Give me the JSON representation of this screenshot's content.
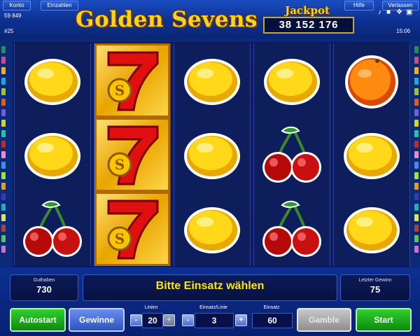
{
  "header": {
    "menu": [
      "Konto",
      "Einzahlen",
      "Hilfe",
      "Verlassen"
    ],
    "account_value": "59 849",
    "ticket": "#25",
    "clock": "15:06",
    "title": "Golden Sevens",
    "jackpot_label": "Jackpot",
    "jackpot_value": "38 152 176",
    "icons": [
      "music-note-icon",
      "speaker-icon",
      "settings-icon",
      "fullscreen-icon"
    ]
  },
  "reels": [
    [
      "lemon",
      "lemon",
      "cherry"
    ],
    [
      "seven",
      "seven",
      "seven"
    ],
    [
      "lemon",
      "lemon",
      "lemon"
    ],
    [
      "lemon",
      "cherry",
      "cherry"
    ],
    [
      "orange",
      "lemon",
      "lemon"
    ]
  ],
  "winning_reel": 1,
  "side_colors": [
    "#2e8b57",
    "#d04a8a",
    "#f0b020",
    "#2aa0d8",
    "#9ac23c",
    "#e05a1a",
    "#7a5ad0",
    "#d8d030",
    "#2cc2a0",
    "#c02a2a",
    "#f08ad0",
    "#4a8ae0",
    "#a0e040",
    "#e09a30",
    "#3a3ab0",
    "#20b0b0",
    "#e0e060",
    "#b04040",
    "#60c060",
    "#d070d0"
  ],
  "status": {
    "balance_label": "Guthaben",
    "balance_value": "730",
    "message": "Bitte Einsatz wählen",
    "last_win_label": "Letzter Gewinn",
    "last_win_value": "75"
  },
  "controls": {
    "autostart": "Autostart",
    "gewinne": "Gewinne",
    "lines_label": "Linien",
    "lines_value": "20",
    "bet_per_line_label": "Einsatz/Linie",
    "bet_per_line_value": "3",
    "bet_label": "Einsatz",
    "bet_value": "60",
    "gamble": "Gamble",
    "start": "Start",
    "minus": "-",
    "plus": "+"
  }
}
